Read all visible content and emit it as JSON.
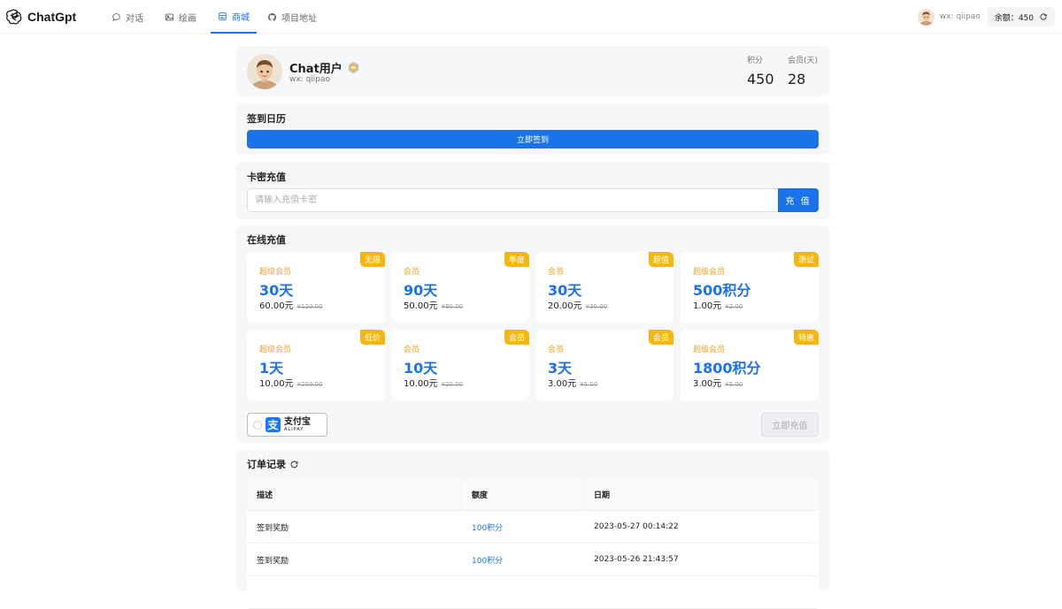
{
  "app": {
    "logo_text": "ChatGpt"
  },
  "nav": [
    {
      "label": "对话",
      "icon": "chat-icon"
    },
    {
      "label": "绘画",
      "icon": "image-icon"
    },
    {
      "label": "商城",
      "icon": "store-icon",
      "active": true
    },
    {
      "label": "项目地址",
      "icon": "github-icon"
    }
  ],
  "topbar": {
    "user": "wx: qiipao",
    "balance_label": "余额：",
    "balance_value": "450"
  },
  "profile": {
    "name": "Chat用户",
    "sub": "wx: qiipao",
    "points_label": "积分",
    "points_value": "450",
    "member_label": "会员(天)",
    "member_value": "28"
  },
  "signin": {
    "title": "签到日历",
    "button": "立即签到"
  },
  "cardkey": {
    "title": "卡密充值",
    "placeholder": "请输入充值卡密",
    "value": "",
    "button": "充 值"
  },
  "online": {
    "title": "在线充值",
    "packages": [
      {
        "tag": "无限",
        "name": "超级会员",
        "amount": "30天",
        "price": "60.00元",
        "orig": "¥120.00"
      },
      {
        "tag": "季度",
        "name": "会员",
        "amount": "90天",
        "price": "50.00元",
        "orig": "¥80.00"
      },
      {
        "tag": "超值",
        "name": "会员",
        "amount": "30天",
        "price": "20.00元",
        "orig": "¥30.00"
      },
      {
        "tag": "测试",
        "name": "超级会员",
        "amount": "500积分",
        "price": "1.00元",
        "orig": "¥2.00"
      },
      {
        "tag": "低价",
        "name": "超级会员",
        "amount": "1天",
        "price": "10.00元",
        "orig": "¥200.00"
      },
      {
        "tag": "会员",
        "name": "会员",
        "amount": "10天",
        "price": "10.00元",
        "orig": "¥20.00"
      },
      {
        "tag": "会员",
        "name": "会员",
        "amount": "3天",
        "price": "3.00元",
        "orig": "¥5.00"
      },
      {
        "tag": "特惠",
        "name": "超级会员",
        "amount": "1800积分",
        "price": "3.00元",
        "orig": "¥5.00"
      }
    ],
    "alipay_cn": "支付宝",
    "alipay_en": "ALIPAY",
    "recharge_button": "立即充值"
  },
  "orders": {
    "title": "订单记录",
    "columns": [
      "描述",
      "额度",
      "日期"
    ],
    "rows": [
      [
        "签到奖励",
        "100积分",
        "2023-05-27 00:14:22"
      ],
      [
        "签到奖励",
        "100积分",
        "2023-05-26 21:43:57"
      ]
    ]
  },
  "colors": {
    "accent": "#1a73e8",
    "tag": "#f5b70f",
    "card_bg": "#f6f7f9"
  }
}
